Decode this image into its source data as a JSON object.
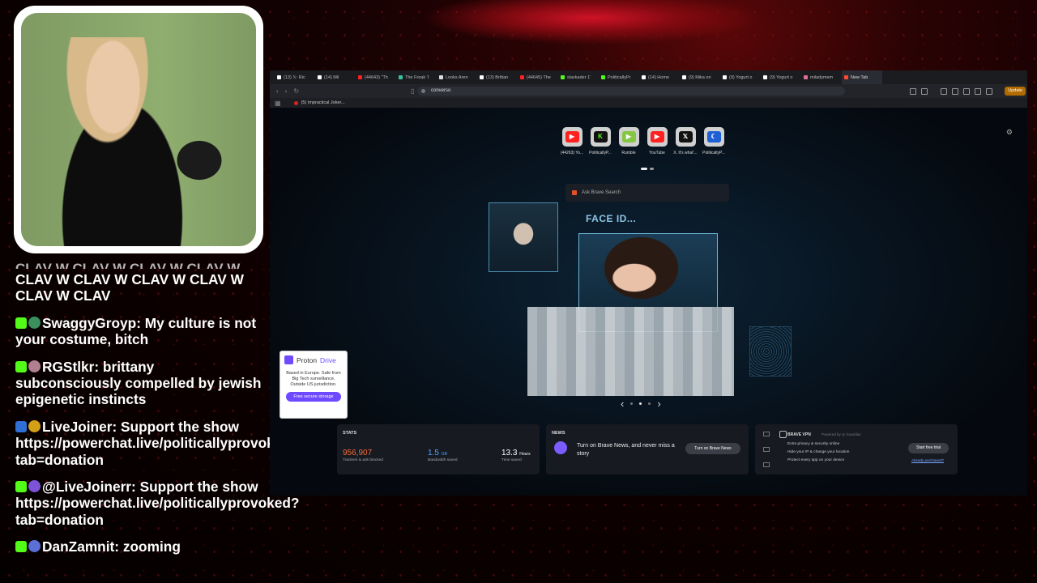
{
  "chat": {
    "cut_line": "CLAV W CLAV W CLAV W CLAV W",
    "lead": "CLAV W CLAV W CLAV W CLAV W CLAV W CLAV",
    "messages": [
      {
        "user": "SwaggyGroyp:",
        "text": "My culture is not your costume, bitch",
        "badge_color": "#53fc18",
        "badge2_color": "#3a8f5c"
      },
      {
        "user": "RGStlkr:",
        "text": "brittany subconsciously compelled by jewish epigenetic instincts",
        "badge_color": "#53fc18",
        "badge2_color": "#b08090"
      },
      {
        "user": "LiveJoiner:",
        "text": "Support the show https://powerchat.live/politicallyprovoked?tab=donation",
        "badge_color": "#2f6fd6",
        "badge2_color": "#d4a017"
      },
      {
        "user": "@LiveJoinerr:",
        "text": "Support the show https://powerchat.live/politicallyprovoked?tab=donation",
        "badge_color": "#53fc18",
        "badge2_color": "#7d54d8"
      },
      {
        "user": "DanZamnit:",
        "text": "zooming",
        "badge_color": "#53fc18",
        "badge2_color": "#5b6fd6"
      }
    ]
  },
  "browser": {
    "tabs": [
      {
        "label": "(13) 𝕏: Ric",
        "color": "#ffffff"
      },
      {
        "label": "(14) Mil",
        "color": "#ffffff"
      },
      {
        "label": "(44643) \"Th",
        "color": "#ff2020"
      },
      {
        "label": "The Freak 'I",
        "color": "#36c4a0"
      },
      {
        "label": "Looks Aren",
        "color": "#dddddd"
      },
      {
        "label": "(13) Brittan",
        "color": "#ffffff"
      },
      {
        "label": "(44645) The",
        "color": "#ff2020"
      },
      {
        "label": "slavkader 1'",
        "color": "#53fc18"
      },
      {
        "label": "PoliticallyPr",
        "color": "#53fc18"
      },
      {
        "label": "(14) Home",
        "color": "#ffffff"
      },
      {
        "label": "(9) Mika on",
        "color": "#ffffff"
      },
      {
        "label": "(9) Yogurt o",
        "color": "#ffffff"
      },
      {
        "label": "(9) Yogurt o",
        "color": "#ffffff"
      },
      {
        "label": "miladymem",
        "color": "#e07090"
      },
      {
        "label": "New Tab",
        "color": "#ff4a30"
      }
    ],
    "address": "converso",
    "update_label": "Update",
    "bookmark": "(5) Impractical Joker..."
  },
  "newtab": {
    "tiles": [
      {
        "label": "(44263) Yo...",
        "glyph": "▶",
        "bg": "#ff2020",
        "fg": "#ffffff"
      },
      {
        "label": "PoliticallyP...",
        "glyph": "K",
        "bg": "#111111",
        "fg": "#53fc18"
      },
      {
        "label": "Rumble",
        "glyph": "▶",
        "bg": "#85c742",
        "fg": "#ffffff"
      },
      {
        "label": "YouTube",
        "glyph": "▶",
        "bg": "#ff2020",
        "fg": "#ffffff"
      },
      {
        "label": "X. It's what'...",
        "glyph": "𝕏",
        "bg": "#111111",
        "fg": "#ffffff"
      },
      {
        "label": "PoliticallyP...",
        "glyph": "☾",
        "bg": "#1f5fd6",
        "fg": "#ffffff"
      }
    ],
    "search_placeholder": "Ask Brave Search",
    "hero_title": "FACE ID...",
    "proton": {
      "brand": "Proton",
      "product": "Drive",
      "body": "Based in Europe. Safe from Big Tech surveillance. Outside US jurisdiction.",
      "button": "Free secure storage"
    },
    "stats": {
      "title": "STATS",
      "trackers_value": "956,907",
      "trackers_label": "Trackers & ads blocked",
      "bandwidth_value": "1.5",
      "bandwidth_unit": "GB",
      "bandwidth_label": "Bandwidth saved",
      "time_value": "13.3",
      "time_unit": "Hours",
      "time_label": "Time saved"
    },
    "news": {
      "title": "NEWS",
      "text": "Turn on Brave News, and never miss a story",
      "button": "Turn on Brave News"
    },
    "vpn": {
      "title": "BRAVE VPN",
      "powered_by": "Powered by ◎ Guardian",
      "items": [
        "Extra privacy & security online",
        "Hide your IP & change your location",
        "Protect every app on your device"
      ],
      "button": "Start free trial",
      "link": "Already purchased?"
    }
  },
  "colors": {
    "accent_green": "#53fc18",
    "brave_orange": "#e2502a",
    "proton_purple": "#6d4aff"
  }
}
